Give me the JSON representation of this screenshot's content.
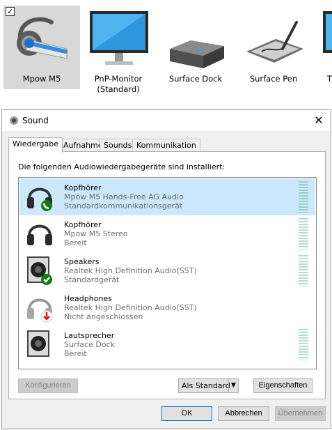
{
  "devices": [
    {
      "label": "Mpow M5",
      "selected": true,
      "checked": true,
      "icon": "headset-icon"
    },
    {
      "label": "PnP-Monitor\n(Standard)",
      "icon": "monitor-icon"
    },
    {
      "label": "Surface Dock",
      "icon": "dock-icon"
    },
    {
      "label": "Surface Pen",
      "icon": "pen-tablet-icon"
    },
    {
      "label": "T",
      "icon": "partial-device-icon"
    }
  ],
  "dialog": {
    "title": "Sound",
    "tabs": [
      "Wiedergabe",
      "Aufnahme",
      "Sounds",
      "Kommunikation"
    ],
    "intro": "Die folgenden Audiowiedergabegeräte sind installiert:",
    "rows": [
      {
        "name": "Kopfhörer",
        "desc": "Mpow M5 Hands-Free AG Audio",
        "status": "Standardkommunikationsgerät",
        "badge": "phone-badge-icon",
        "icon": "headphones-icon"
      },
      {
        "name": "Kopfhörer",
        "desc": "Mpow M5 Stereo",
        "status": "Bereit",
        "badge": "",
        "icon": "headphones-icon"
      },
      {
        "name": "Speakers",
        "desc": "Realtek High Definition Audio(SST)",
        "status": "Standardgerät",
        "badge": "checkmark-badge-icon",
        "icon": "speaker-icon"
      },
      {
        "name": "Headphones",
        "desc": "Realtek High Definition Audio(SST)",
        "status": "Nicht angeschlossen",
        "badge": "disconnected-badge-icon",
        "icon": "headphones-icon"
      },
      {
        "name": "Lautsprecher",
        "desc": "Surface Dock",
        "status": "Bereit",
        "badge": "",
        "icon": "speaker-icon"
      }
    ],
    "buttons": {
      "configure": "Konfigurieren",
      "set_default": "Als Standard",
      "properties": "Eigenschaften",
      "ok": "OK",
      "cancel": "Abbrechen",
      "apply": "Übernehmen"
    },
    "colors": {
      "selection": "#cce8ff",
      "accent": "#0078d7",
      "ok_green": "#107c10",
      "error_red": "#e81123"
    }
  }
}
